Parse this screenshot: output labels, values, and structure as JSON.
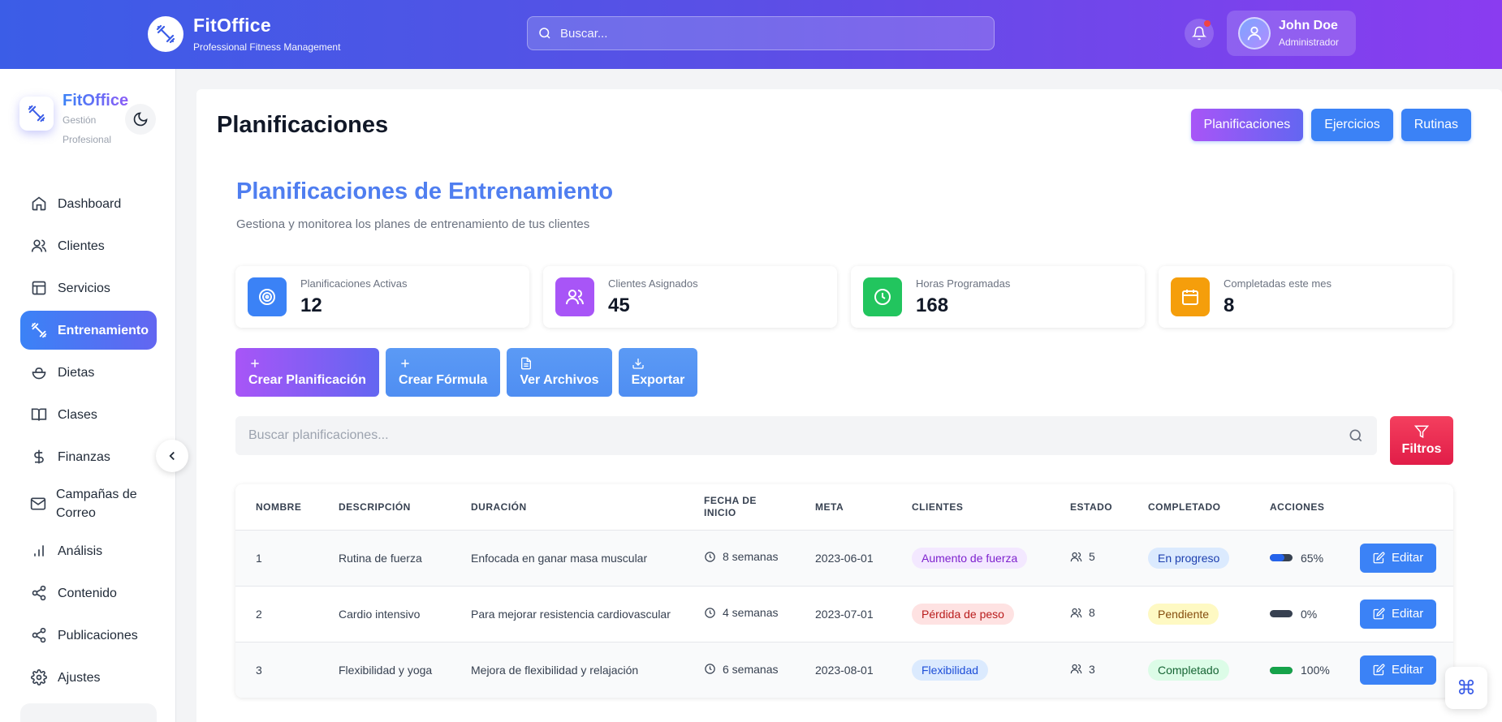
{
  "topbar": {
    "brand_title": "FitOffice",
    "brand_subtitle": "Professional Fitness Management",
    "search_placeholder": "Buscar...",
    "user_name": "John Doe",
    "user_role": "Administrador"
  },
  "sidebar": {
    "brand_title": "FitOffice",
    "brand_subtitle": "Gestión Profesional",
    "items": [
      {
        "label": "Dashboard",
        "icon": "home-icon"
      },
      {
        "label": "Clientes",
        "icon": "users-icon"
      },
      {
        "label": "Servicios",
        "icon": "layout-icon"
      },
      {
        "label": "Entrenamiento",
        "icon": "dumbbell-icon",
        "active": true
      },
      {
        "label": "Dietas",
        "icon": "salad-icon"
      },
      {
        "label": "Clases",
        "icon": "book-icon"
      },
      {
        "label": "Finanzas",
        "icon": "dollar-icon"
      },
      {
        "label": "Campañas de Correo",
        "icon": "mail-icon"
      },
      {
        "label": "Análisis",
        "icon": "bar-chart-icon"
      },
      {
        "label": "Contenido",
        "icon": "share-icon"
      },
      {
        "label": "Publicaciones",
        "icon": "share-icon"
      },
      {
        "label": "Ajustes",
        "icon": "gear-icon"
      }
    ]
  },
  "main": {
    "page_title": "Planificaciones",
    "tabs": [
      "Planificaciones",
      "Ejercicios",
      "Rutinas"
    ],
    "section_title": "Planificaciones de Entrenamiento",
    "section_subtitle": "Gestiona y monitorea los planes de entrenamiento de tus clientes",
    "stats": [
      {
        "label": "Planificaciones Activas",
        "value": "12",
        "color": "#3b82f6",
        "icon": "target-icon"
      },
      {
        "label": "Clientes Asignados",
        "value": "45",
        "color": "#a855f7",
        "icon": "users-icon"
      },
      {
        "label": "Horas Programadas",
        "value": "168",
        "color": "#22c55e",
        "icon": "clock-icon"
      },
      {
        "label": "Completadas este mes",
        "value": "8",
        "color": "#f59e0b",
        "icon": "calendar-icon"
      }
    ],
    "actions": [
      {
        "label": "Crear Planificación",
        "icon": "plus-icon"
      },
      {
        "label": "Crear Fórmula",
        "icon": "plus-icon"
      },
      {
        "label": "Ver Archivos",
        "icon": "file-icon"
      },
      {
        "label": "Exportar",
        "icon": "download-icon"
      }
    ],
    "search_placeholder": "Buscar planificaciones...",
    "filters_label": "Filtros",
    "table": {
      "headers": [
        "NOMBRE",
        "DESCRIPCIÓN",
        "DURACIÓN",
        "FECHA DE INICIO",
        "META",
        "CLIENTES",
        "ESTADO",
        "COMPLETADO",
        "ACCIONES"
      ],
      "rows": [
        {
          "id": "1",
          "name": "Rutina de fuerza",
          "description": "Enfocada en ganar masa muscular",
          "duration": "8 semanas",
          "start": "2023-06-01",
          "goal": "Aumento de fuerza",
          "goal_color": "purple",
          "clients": "5",
          "status": "En progreso",
          "status_color": "sblue",
          "progress": 65,
          "progress_label": "65%",
          "edit": "Editar"
        },
        {
          "id": "2",
          "name": "Cardio intensivo",
          "description": "Para mejorar resistencia cardiovascular",
          "duration": "4 semanas",
          "start": "2023-07-01",
          "goal": "Pérdida de peso",
          "goal_color": "red",
          "clients": "8",
          "status": "Pendiente",
          "status_color": "yellow",
          "progress": 0,
          "progress_label": "0%",
          "edit": "Editar"
        },
        {
          "id": "3",
          "name": "Flexibilidad y yoga",
          "description": "Mejora de flexibilidad y relajación",
          "duration": "6 semanas",
          "start": "2023-08-01",
          "goal": "Flexibilidad",
          "goal_color": "blue",
          "clients": "3",
          "status": "Completado",
          "status_color": "green",
          "progress": 100,
          "progress_label": "100%",
          "edit": "Editar"
        }
      ]
    }
  },
  "colors": {
    "accent": "#3b82f6",
    "brand_gradient_start": "#3b5de7",
    "brand_gradient_end": "#8a3cf0"
  }
}
